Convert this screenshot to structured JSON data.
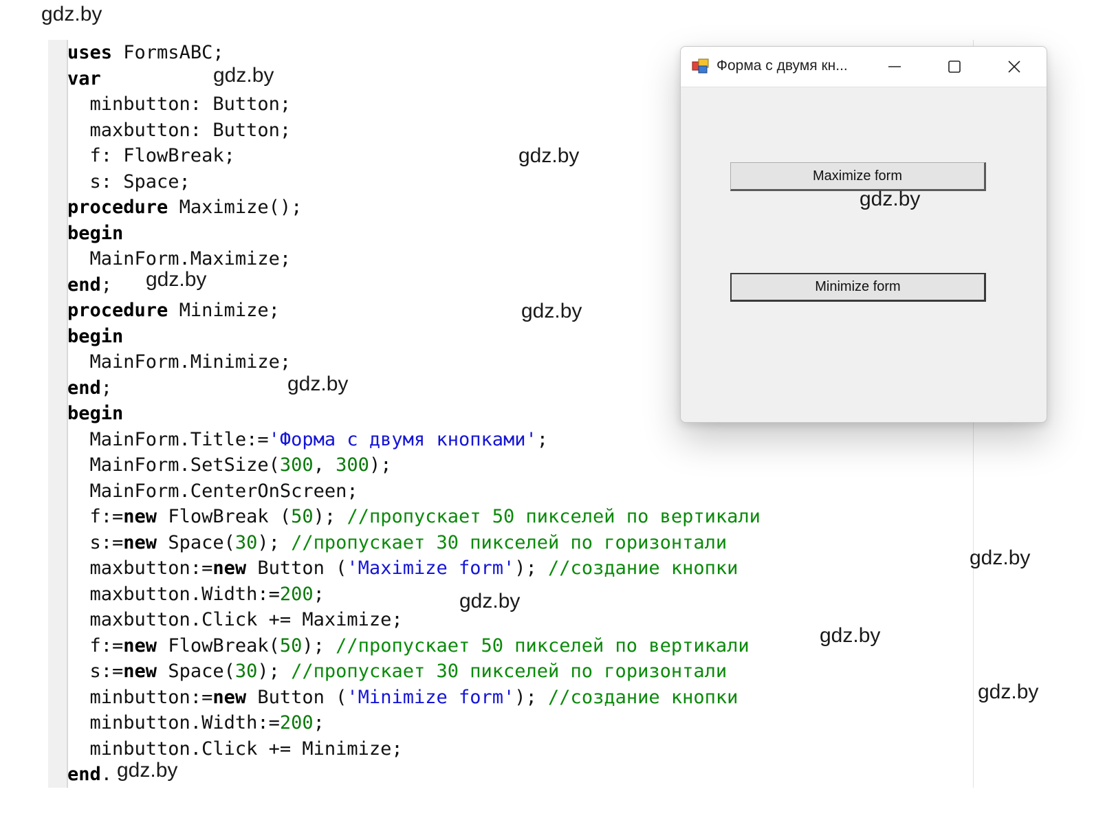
{
  "watermark": "gdz.by",
  "code_lines": [
    [
      {
        "t": "uses",
        "c": "kw"
      },
      {
        "t": " FormsABC;",
        "c": "pl"
      }
    ],
    [
      {
        "t": "var",
        "c": "kw"
      }
    ],
    [
      {
        "t": "  minbutton: Button;",
        "c": "pl"
      }
    ],
    [
      {
        "t": "  maxbutton: Button;",
        "c": "pl"
      }
    ],
    [
      {
        "t": "  f: FlowBreak;",
        "c": "pl"
      }
    ],
    [
      {
        "t": "  s: Space;",
        "c": "pl"
      }
    ],
    [
      {
        "t": "procedure",
        "c": "kw"
      },
      {
        "t": " Maximize();",
        "c": "pl"
      }
    ],
    [
      {
        "t": "begin",
        "c": "kw"
      }
    ],
    [
      {
        "t": "  MainForm.Maximize;",
        "c": "pl"
      }
    ],
    [
      {
        "t": "end",
        "c": "kw"
      },
      {
        "t": ";",
        "c": "pl"
      }
    ],
    [
      {
        "t": "procedure",
        "c": "kw"
      },
      {
        "t": " Minimize;",
        "c": "pl"
      }
    ],
    [
      {
        "t": "begin",
        "c": "kw"
      }
    ],
    [
      {
        "t": "  MainForm.Minimize;",
        "c": "pl"
      }
    ],
    [
      {
        "t": "end",
        "c": "kw"
      },
      {
        "t": ";",
        "c": "pl"
      }
    ],
    [
      {
        "t": "begin",
        "c": "kw"
      }
    ],
    [
      {
        "t": "  MainForm.Title:=",
        "c": "pl"
      },
      {
        "t": "'Форма с двумя кнопками'",
        "c": "str"
      },
      {
        "t": ";",
        "c": "pl"
      }
    ],
    [
      {
        "t": "  MainForm.SetSize(",
        "c": "pl"
      },
      {
        "t": "300",
        "c": "num"
      },
      {
        "t": ", ",
        "c": "pl"
      },
      {
        "t": "300",
        "c": "num"
      },
      {
        "t": ");",
        "c": "pl"
      }
    ],
    [
      {
        "t": "  MainForm.CenterOnScreen;",
        "c": "pl"
      }
    ],
    [
      {
        "t": "  f:=",
        "c": "pl"
      },
      {
        "t": "new",
        "c": "kw"
      },
      {
        "t": " FlowBreak (",
        "c": "pl"
      },
      {
        "t": "50",
        "c": "num"
      },
      {
        "t": "); ",
        "c": "pl"
      },
      {
        "t": "//пропускает 50 пикселей по вертикали",
        "c": "cmt"
      }
    ],
    [
      {
        "t": "  s:=",
        "c": "pl"
      },
      {
        "t": "new",
        "c": "kw"
      },
      {
        "t": " Space(",
        "c": "pl"
      },
      {
        "t": "30",
        "c": "num"
      },
      {
        "t": "); ",
        "c": "pl"
      },
      {
        "t": "//пропускает 30 пикселей по горизонтали",
        "c": "cmt"
      }
    ],
    [
      {
        "t": "  maxbutton:=",
        "c": "pl"
      },
      {
        "t": "new",
        "c": "kw"
      },
      {
        "t": " Button (",
        "c": "pl"
      },
      {
        "t": "'Maximize form'",
        "c": "str"
      },
      {
        "t": "); ",
        "c": "pl"
      },
      {
        "t": "//создание кнопки",
        "c": "cmt"
      }
    ],
    [
      {
        "t": "  maxbutton.Width:=",
        "c": "pl"
      },
      {
        "t": "200",
        "c": "num"
      },
      {
        "t": ";",
        "c": "pl"
      }
    ],
    [
      {
        "t": "  maxbutton.Click += Maximize;",
        "c": "pl"
      }
    ],
    [
      {
        "t": "  f:=",
        "c": "pl"
      },
      {
        "t": "new",
        "c": "kw"
      },
      {
        "t": " FlowBreak(",
        "c": "pl"
      },
      {
        "t": "50",
        "c": "num"
      },
      {
        "t": "); ",
        "c": "pl"
      },
      {
        "t": "//пропускает 50 пикселей по вертикали",
        "c": "cmt"
      }
    ],
    [
      {
        "t": "  s:=",
        "c": "pl"
      },
      {
        "t": "new",
        "c": "kw"
      },
      {
        "t": " Space(",
        "c": "pl"
      },
      {
        "t": "30",
        "c": "num"
      },
      {
        "t": "); ",
        "c": "pl"
      },
      {
        "t": "//пропускает 30 пикселей по горизонтали",
        "c": "cmt"
      }
    ],
    [
      {
        "t": "  minbutton:=",
        "c": "pl"
      },
      {
        "t": "new",
        "c": "kw"
      },
      {
        "t": " Button (",
        "c": "pl"
      },
      {
        "t": "'Minimize form'",
        "c": "str"
      },
      {
        "t": "); ",
        "c": "pl"
      },
      {
        "t": "//создание кнопки",
        "c": "cmt"
      }
    ],
    [
      {
        "t": "  minbutton.Width:=",
        "c": "pl"
      },
      {
        "t": "200",
        "c": "num"
      },
      {
        "t": ";",
        "c": "pl"
      }
    ],
    [
      {
        "t": "  minbutton.Click += Minimize;",
        "c": "pl"
      }
    ],
    [
      {
        "t": "end",
        "c": "kw"
      },
      {
        "t": ".",
        "c": "pl"
      }
    ]
  ],
  "window": {
    "title": "Форма с двумя кн...",
    "maximize_button_label": "Maximize form",
    "minimize_button_label": "Minimize form",
    "icons": {
      "app": "app-icon",
      "minimize": "window-minimize-icon",
      "maximize": "window-maximize-icon",
      "close": "window-close-icon"
    }
  },
  "colors": {
    "keyword": "#000000",
    "string": "#1515d6",
    "number": "#0a7a0a",
    "comment": "#0a8a0a",
    "gutter": "#f0f0f0",
    "window_bg": "#f0f0f0"
  }
}
